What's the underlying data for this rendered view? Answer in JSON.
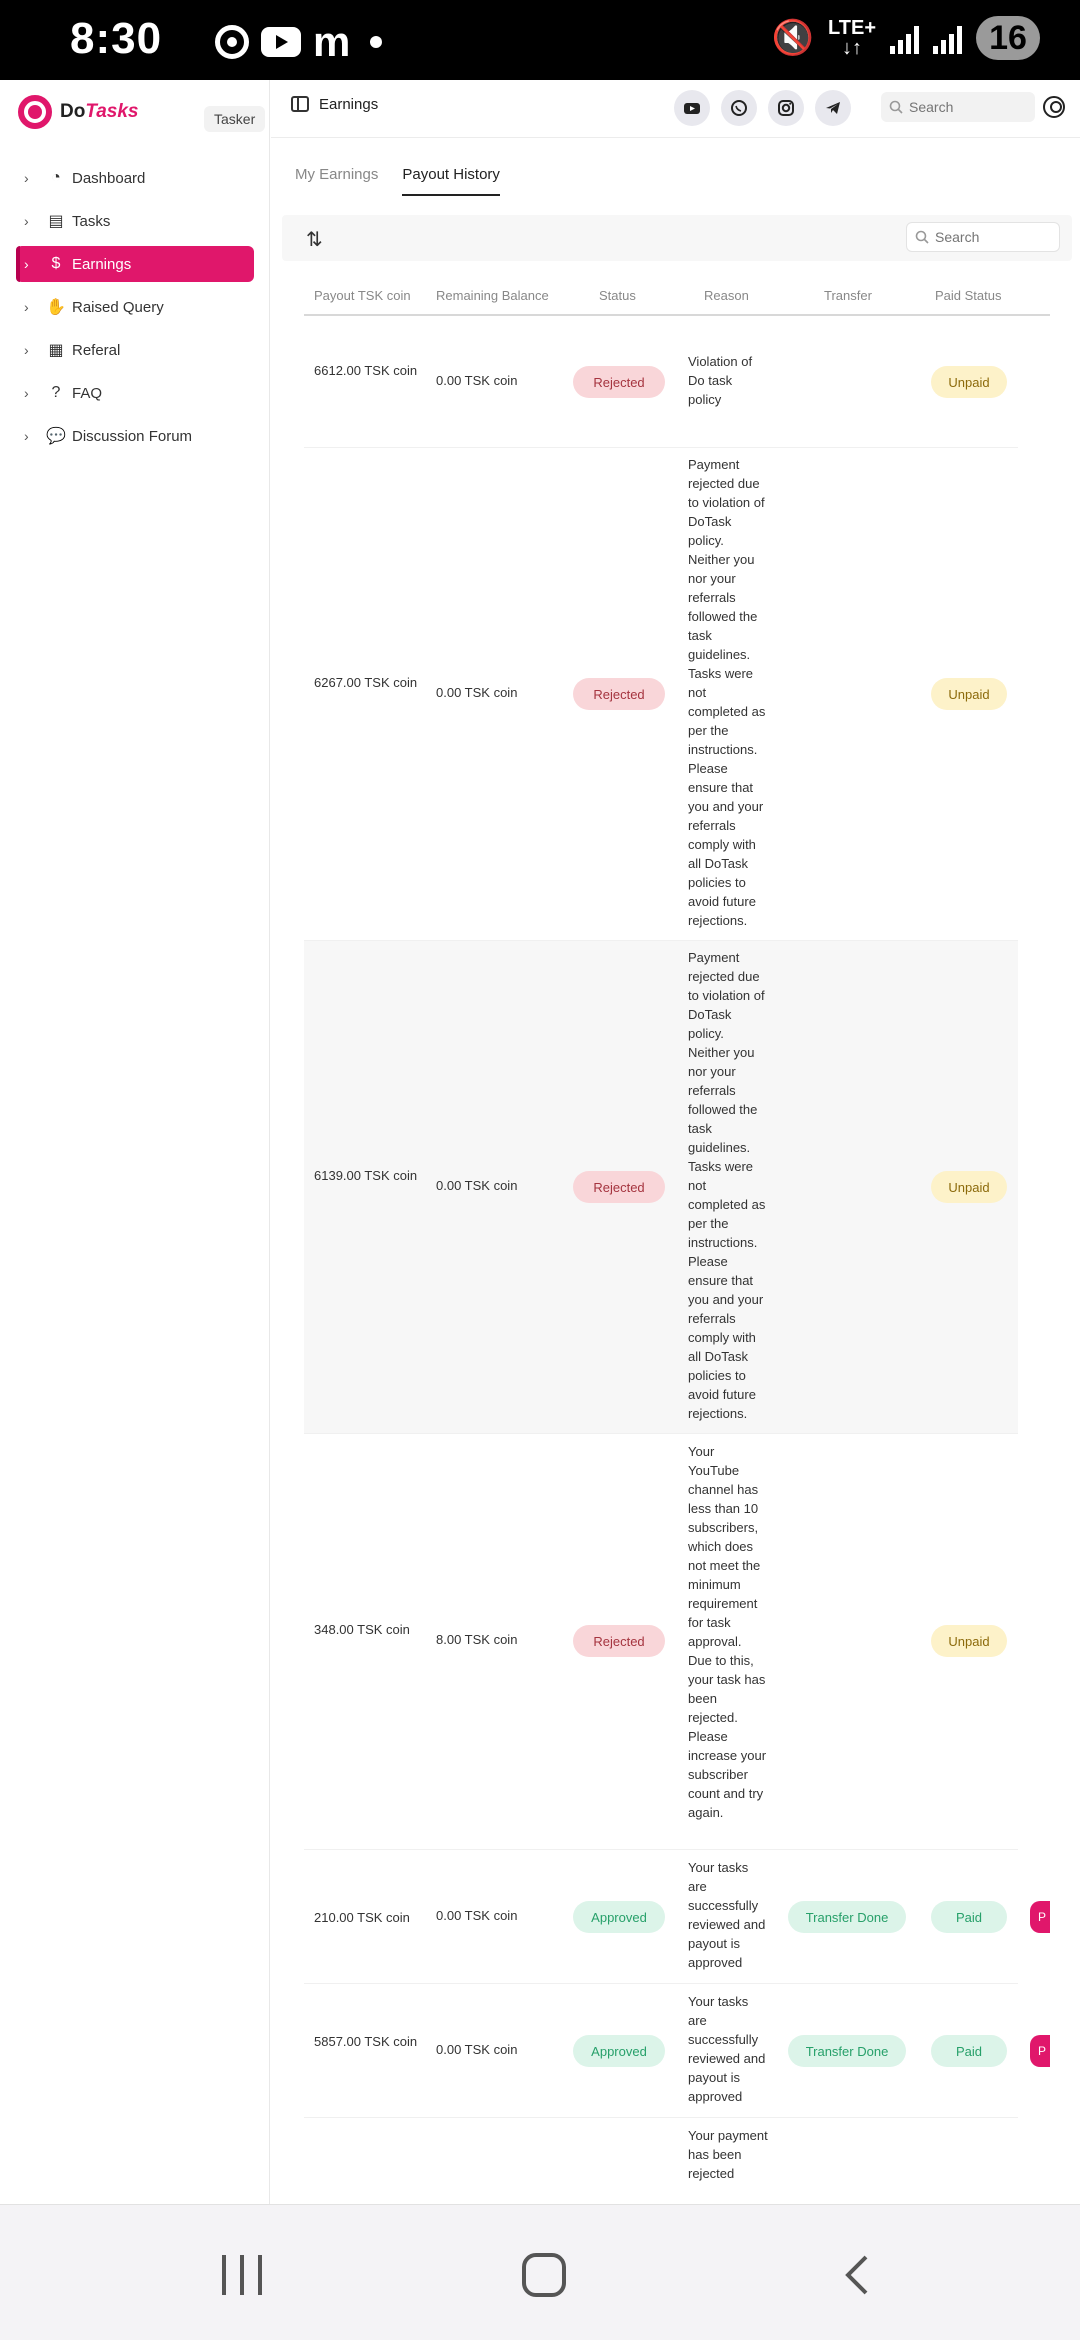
{
  "status_bar": {
    "time": "8:30",
    "network": "LTE+",
    "battery": "16",
    "icons": [
      "chrome-icon",
      "youtube-icon",
      "gmail-icon",
      "dot-icon",
      "mute-icon",
      "signal-icon",
      "battery-icon"
    ]
  },
  "app": {
    "brand_prefix": "Do",
    "brand_suffix": "Tasks",
    "role": "Tasker",
    "accent_color": "#e0176b"
  },
  "sidebar": {
    "items": [
      {
        "label": "Dashboard",
        "icon": "dashboard-icon"
      },
      {
        "label": "Tasks",
        "icon": "tasks-icon"
      },
      {
        "label": "Earnings",
        "icon": "dollar-icon"
      },
      {
        "label": "Raised Query",
        "icon": "hand-icon"
      },
      {
        "label": "Referal",
        "icon": "gift-icon"
      },
      {
        "label": "FAQ",
        "icon": "question-icon"
      },
      {
        "label": "Discussion Forum",
        "icon": "chat-icon"
      }
    ],
    "active": "Earnings"
  },
  "header": {
    "breadcrumb": "Earnings",
    "search_placeholder": "Search",
    "social": [
      "youtube-icon",
      "whatsapp-icon",
      "instagram-icon",
      "telegram-icon"
    ]
  },
  "tabs": [
    "My Earnings",
    "Payout History"
  ],
  "active_tab": "Payout History",
  "table": {
    "search_placeholder": "Search",
    "columns": [
      "Payout TSK coin",
      "Remaining Balance",
      "Status",
      "Reason",
      "Transfer",
      "Paid Status"
    ],
    "rows": [
      {
        "payout": "6612.00 TSK coin",
        "remaining": "0.00 TSK coin",
        "status": "Rejected",
        "reason": "Violation of Do task policy",
        "transfer": "",
        "paid_status": "Unpaid"
      },
      {
        "payout": "6267.00 TSK coin",
        "remaining": "0.00 TSK coin",
        "status": "Rejected",
        "reason": "Payment rejected due to violation of DoTask policy. Neither you nor your referrals followed the task guidelines. Tasks were not completed as per the instructions. Please ensure that you and your referrals comply with all DoTask policies to avoid future rejections.",
        "transfer": "",
        "paid_status": "Unpaid"
      },
      {
        "payout": "6139.00 TSK coin",
        "remaining": "0.00 TSK coin",
        "status": "Rejected",
        "reason": "Payment rejected due to violation of DoTask policy. Neither you nor your referrals followed the task guidelines. Tasks were not completed as per the instructions. Please ensure that you and your referrals comply with all DoTask policies to avoid future rejections.",
        "transfer": "",
        "paid_status": "Unpaid"
      },
      {
        "payout": "348.00 TSK coin",
        "remaining": "8.00 TSK coin",
        "status": "Rejected",
        "reason": "Your YouTube channel has less than 10 subscribers, which does not meet the minimum requirement for task approval. Due to this, your task has been rejected. Please increase your subscriber count and try again.",
        "transfer": "",
        "paid_status": "Unpaid"
      },
      {
        "payout": "210.00 TSK coin",
        "remaining": "0.00 TSK coin",
        "status": "Approved",
        "reason": "Your tasks are successfully reviewed and payout is approved",
        "transfer": "Transfer Done",
        "paid_status": "Paid",
        "action": "P"
      },
      {
        "payout": "5857.00 TSK coin",
        "remaining": "0.00 TSK coin",
        "status": "Approved",
        "reason": "Your tasks are successfully reviewed and payout is approved",
        "transfer": "Transfer Done",
        "paid_status": "Paid",
        "action": "P"
      },
      {
        "payout": "",
        "remaining": "",
        "status": "",
        "reason": "Your payment has been rejected",
        "transfer": "",
        "paid_status": ""
      }
    ]
  }
}
